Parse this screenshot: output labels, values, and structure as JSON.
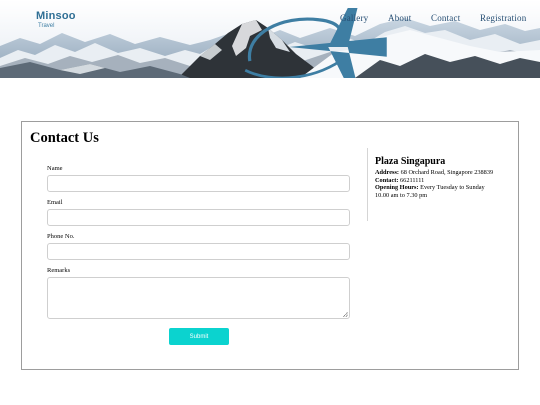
{
  "logo": {
    "name": "Minsoo",
    "tagline": "Travel",
    "icon": "airplane-icon"
  },
  "nav": {
    "items": [
      "Gallery",
      "About",
      "Contact",
      "Registration"
    ]
  },
  "colors": {
    "accent": "#0bd3cf",
    "nav_text": "#264e73",
    "border": "#9d9d9d"
  },
  "contact": {
    "title": "Contact Us",
    "form": {
      "name_label": "Name",
      "email_label": "Email",
      "phone_label": "Phone No.",
      "remarks_label": "Remarks",
      "submit_label": "Submit"
    },
    "location": {
      "name": "Plaza Singapura",
      "address_label": "Address:",
      "address": "68 Orchard Road, Singapore 238839",
      "contact_label": "Contact:",
      "contact": "66211111",
      "hours_label": "Opening Hours:",
      "hours_line1": "Every Tuesday to Sunday",
      "hours_line2": "10.00 am to 7.30 pm"
    }
  }
}
